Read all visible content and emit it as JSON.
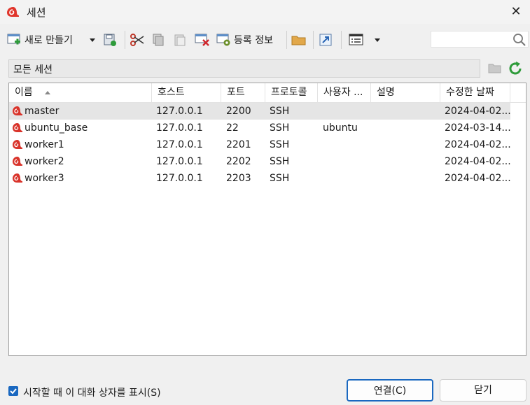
{
  "window": {
    "title": "세션",
    "close_glyph": "✕"
  },
  "toolbar": {
    "new_label": "새로 만들기",
    "register_label": "등록 정보"
  },
  "filter": {
    "label": "모든 세션"
  },
  "columns": [
    "이름",
    "호스트",
    "포트",
    "프로토콜",
    "사용자 ...",
    "설명",
    "수정한 날짜"
  ],
  "sessions": [
    {
      "name": "master",
      "host": "127.0.0.1",
      "port": "2200",
      "protocol": "SSH",
      "user": "",
      "desc": "",
      "modified": "2024-04-02..."
    },
    {
      "name": "ubuntu_base",
      "host": "127.0.0.1",
      "port": "22",
      "protocol": "SSH",
      "user": "ubuntu",
      "desc": "",
      "modified": "2024-03-14..."
    },
    {
      "name": "worker1",
      "host": "127.0.0.1",
      "port": "2201",
      "protocol": "SSH",
      "user": "",
      "desc": "",
      "modified": "2024-04-02..."
    },
    {
      "name": "worker2",
      "host": "127.0.0.1",
      "port": "2202",
      "protocol": "SSH",
      "user": "",
      "desc": "",
      "modified": "2024-04-02..."
    },
    {
      "name": "worker3",
      "host": "127.0.0.1",
      "port": "2203",
      "protocol": "SSH",
      "user": "",
      "desc": "",
      "modified": "2024-04-02..."
    }
  ],
  "footer": {
    "show_on_startup_label": "시작할 때 이 대화 상자를 표시(S)",
    "show_on_startup_checked": true,
    "connect_label": "연결(C)",
    "close_label": "닫기"
  },
  "colors": {
    "accent": "#1a68c0",
    "selected_row": "#e5e5e5",
    "session_icon": "#d9342b"
  }
}
